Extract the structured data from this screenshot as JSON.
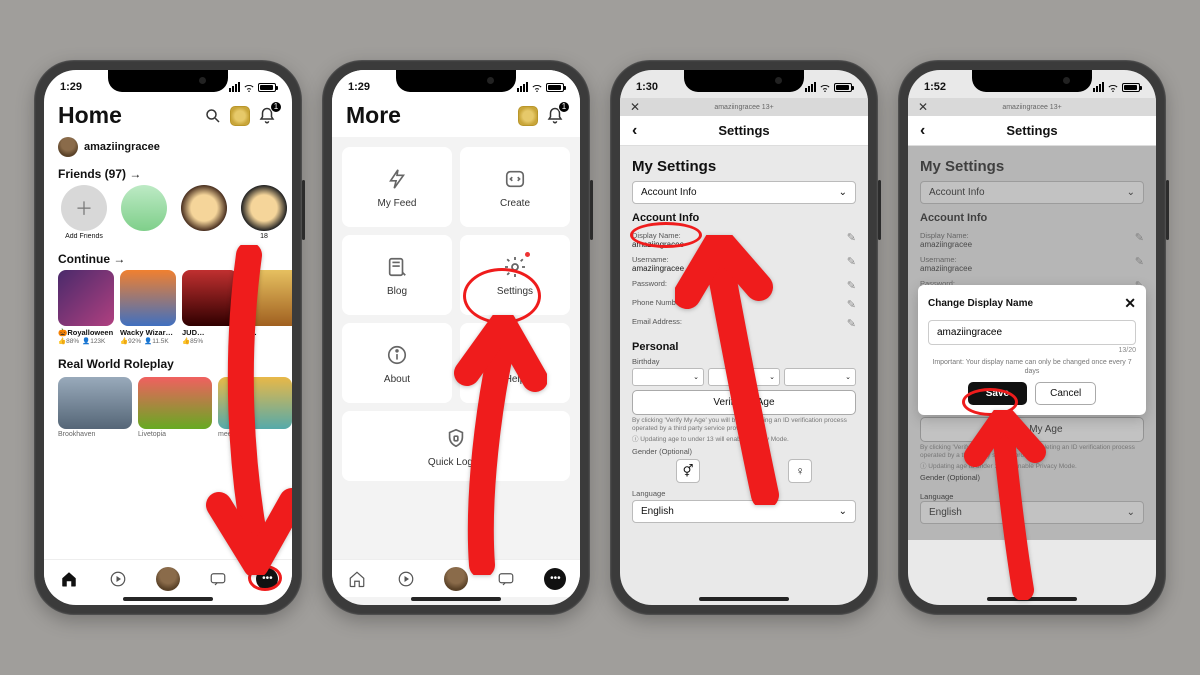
{
  "status": {
    "times": [
      "1:29",
      "1:29",
      "1:30",
      "1:52"
    ]
  },
  "s1": {
    "title": "Home",
    "notif_badge": "1",
    "username": "amaziingracee",
    "friends_label": "Friends (97)  →",
    "friends": [
      {
        "name": "Add Friends"
      },
      {
        "name": " "
      },
      {
        "name": " "
      },
      {
        "name": "18"
      }
    ],
    "continue_label": "Continue  →",
    "games": [
      {
        "title": "🎃Royalloween",
        "rating": "👍88%",
        "plays": "👤123K"
      },
      {
        "title": "Wacky Wizards…",
        "rating": "👍92%",
        "plays": "👤11.5K"
      },
      {
        "title": "JUD…",
        "rating": "👍85%",
        "plays": " "
      },
      {
        "title": "D…",
        "rating": " ",
        "plays": " "
      }
    ],
    "realworld_label": "Real World Roleplay",
    "rw": [
      {
        "title": "Brookhaven"
      },
      {
        "title": "Livetopia"
      },
      {
        "title": "mee…"
      }
    ]
  },
  "s2": {
    "title": "More",
    "notif_badge": "1",
    "tiles": {
      "feed": "My Feed",
      "create": "Create",
      "blog": "Blog",
      "settings": "Settings",
      "about": "About",
      "help": "Help",
      "quick": "Quick Log In"
    }
  },
  "s3": {
    "topstrip": "amaziingracee   13+",
    "header": "Settings",
    "my_settings": "My Settings",
    "account_info_select": "Account Info",
    "account_info_h": "Account Info",
    "display_name_lbl": "Display Name:",
    "display_name_val": "amaziingracee",
    "username_lbl": "Username:",
    "username_val": "amaziingracee",
    "password_lbl": "Password:",
    "phone_lbl": "Phone Number:",
    "email_lbl": "Email Address:",
    "personal_h": "Personal",
    "birthday_lbl": "Birthday",
    "verify_btn": "Verify My Age",
    "verify_fine": "By clicking 'Verify My Age' you will be completing an ID verification process operated by a third party service provider.",
    "privacy_fine": "ⓘ Updating age to under 13 will enable Privacy Mode.",
    "gender_lbl": "Gender (Optional)",
    "language_lbl": "Language",
    "language_val": "English"
  },
  "s4": {
    "modal_title": "Change Display Name",
    "modal_value": "amaziingracee",
    "counter": "13/20",
    "note": "Important: Your display name can only be changed once every 7 days",
    "save": "Save",
    "cancel": "Cancel"
  }
}
